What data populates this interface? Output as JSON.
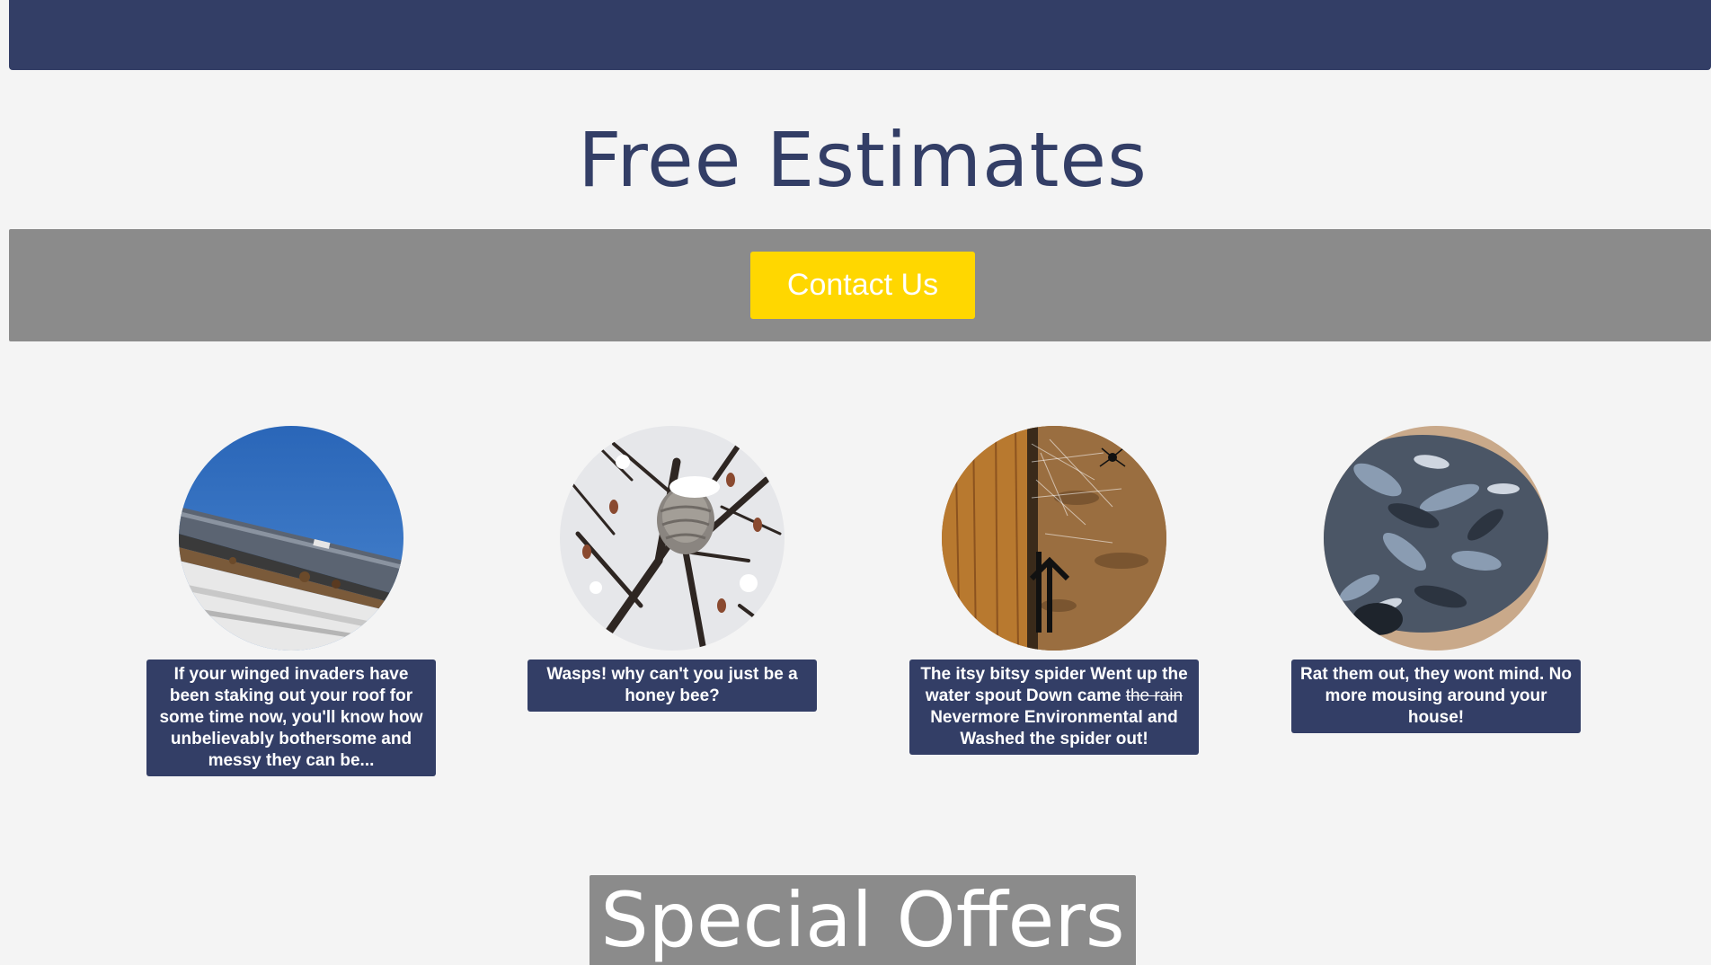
{
  "hero": {
    "title": "Free Estimates"
  },
  "cta": {
    "button_label": "Contact Us"
  },
  "cards": [
    {
      "image": "roof-gutter-photo",
      "caption": "If your winged invaders have been staking out your roof for some time now, you'll know how unbelievably bothersome and messy they can be..."
    },
    {
      "image": "wasp-nest-photo",
      "caption": "Wasps! why can't you just be a honey bee?"
    },
    {
      "image": "spider-web-photo",
      "caption_before": "The itsy bitsy spider Went up the water spout Down came",
      "caption_struck": "the rain",
      "caption_after": "Nevermore Environmental and Washed the spider out!"
    },
    {
      "image": "rat-fur-photo",
      "caption": "Rat them out, they wont mind. No more mousing around your house!"
    }
  ],
  "offers": {
    "title": "Special Offers"
  },
  "colors": {
    "navy": "#333e66",
    "band_gray": "#8b8b8b",
    "cta_yellow": "#ffd700",
    "page_bg": "#f4f4f4"
  }
}
